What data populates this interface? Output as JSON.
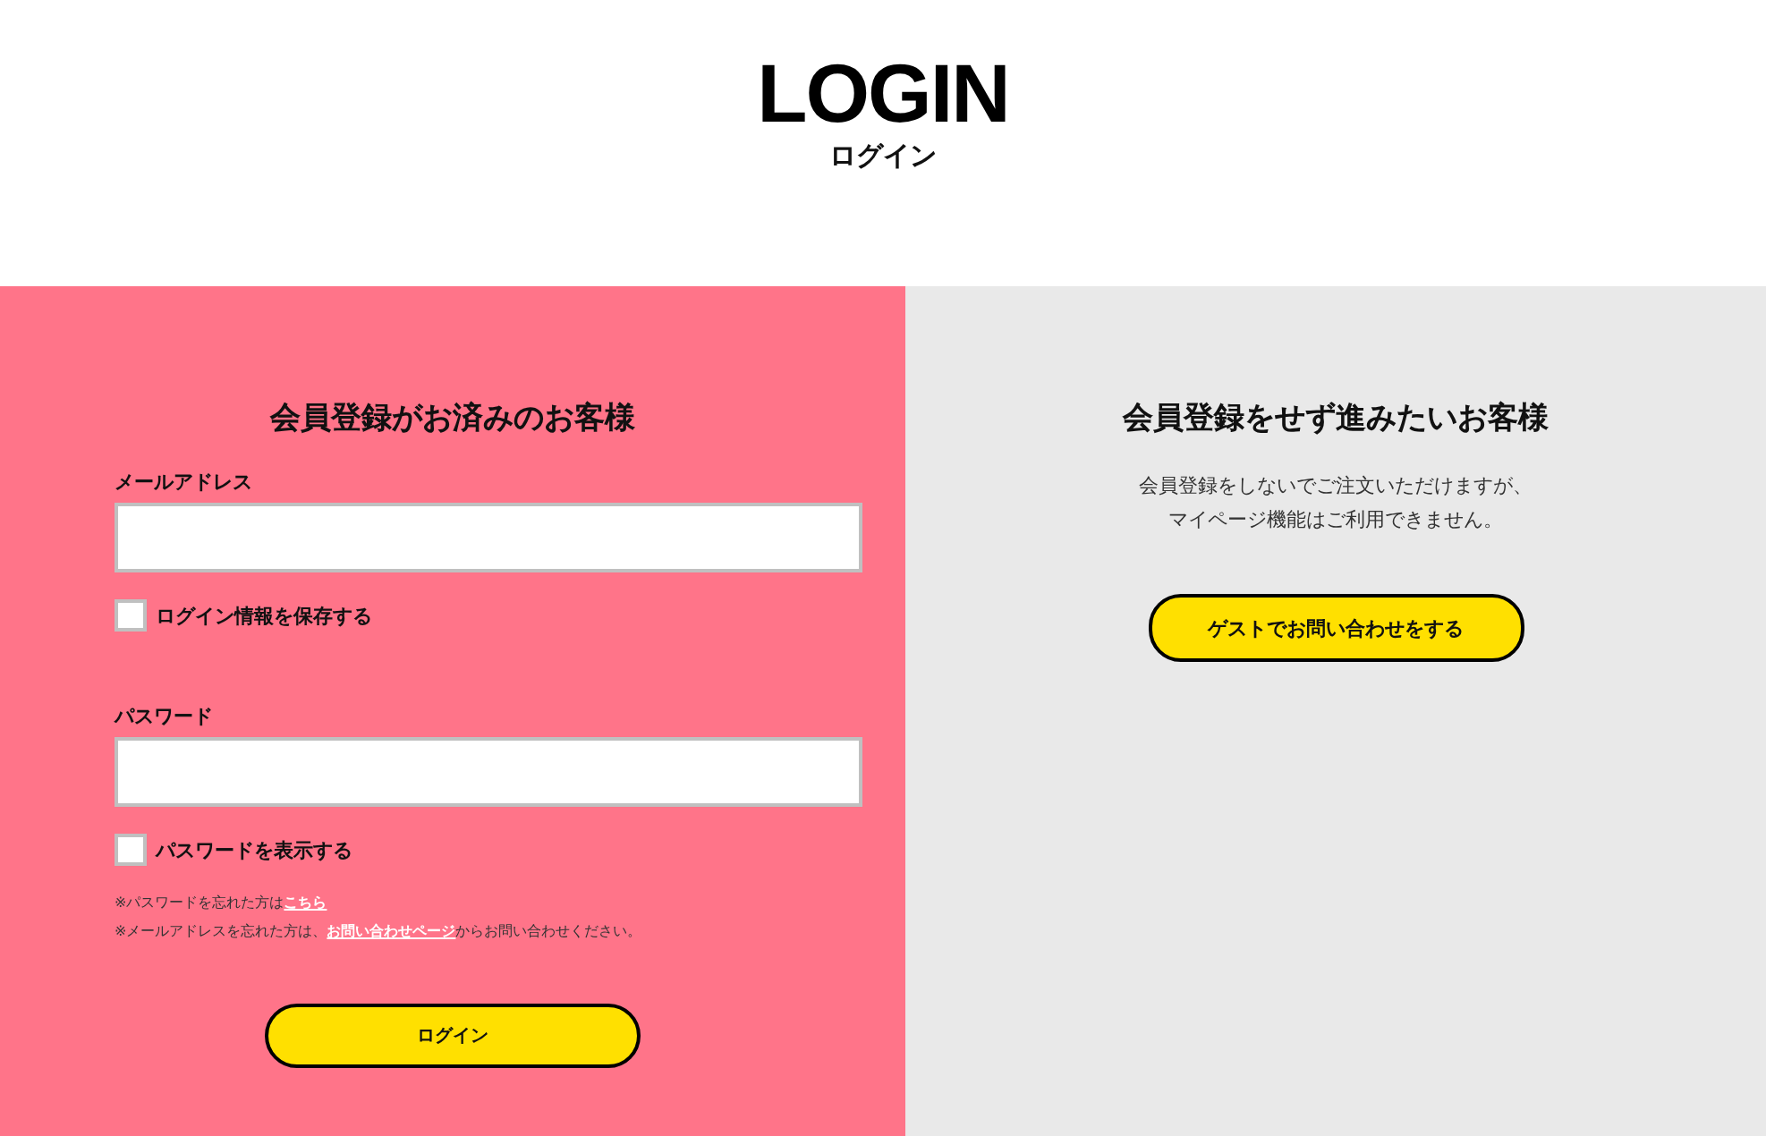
{
  "header": {
    "title": "LOGIN",
    "subtitle": "ログイン"
  },
  "member": {
    "heading": "会員登録がお済みのお客様",
    "fields": [
      {
        "label": "メールアドレス",
        "checkbox": {
          "label": "ログイン情報を保存する",
          "checked": false
        }
      },
      {
        "label": "パスワード",
        "checkbox": {
          "label": "パスワードを表示する",
          "checked": false
        }
      }
    ],
    "notes": [
      {
        "before": "※パスワードを忘れた方は",
        "link": "こちら"
      },
      {
        "before": "※メールアドレスを忘れた方は、",
        "link": "お問い合わせページ",
        "after": "からお問い合わせください。"
      }
    ],
    "button": "ログイン"
  },
  "guest": {
    "heading": "会員登録をせず進みたいお客様",
    "text": [
      "会員登録をしないでご注文いただけますが、",
      "マイページ機能はご利用できません。"
    ],
    "button": "ゲストでお問い合わせをする"
  }
}
